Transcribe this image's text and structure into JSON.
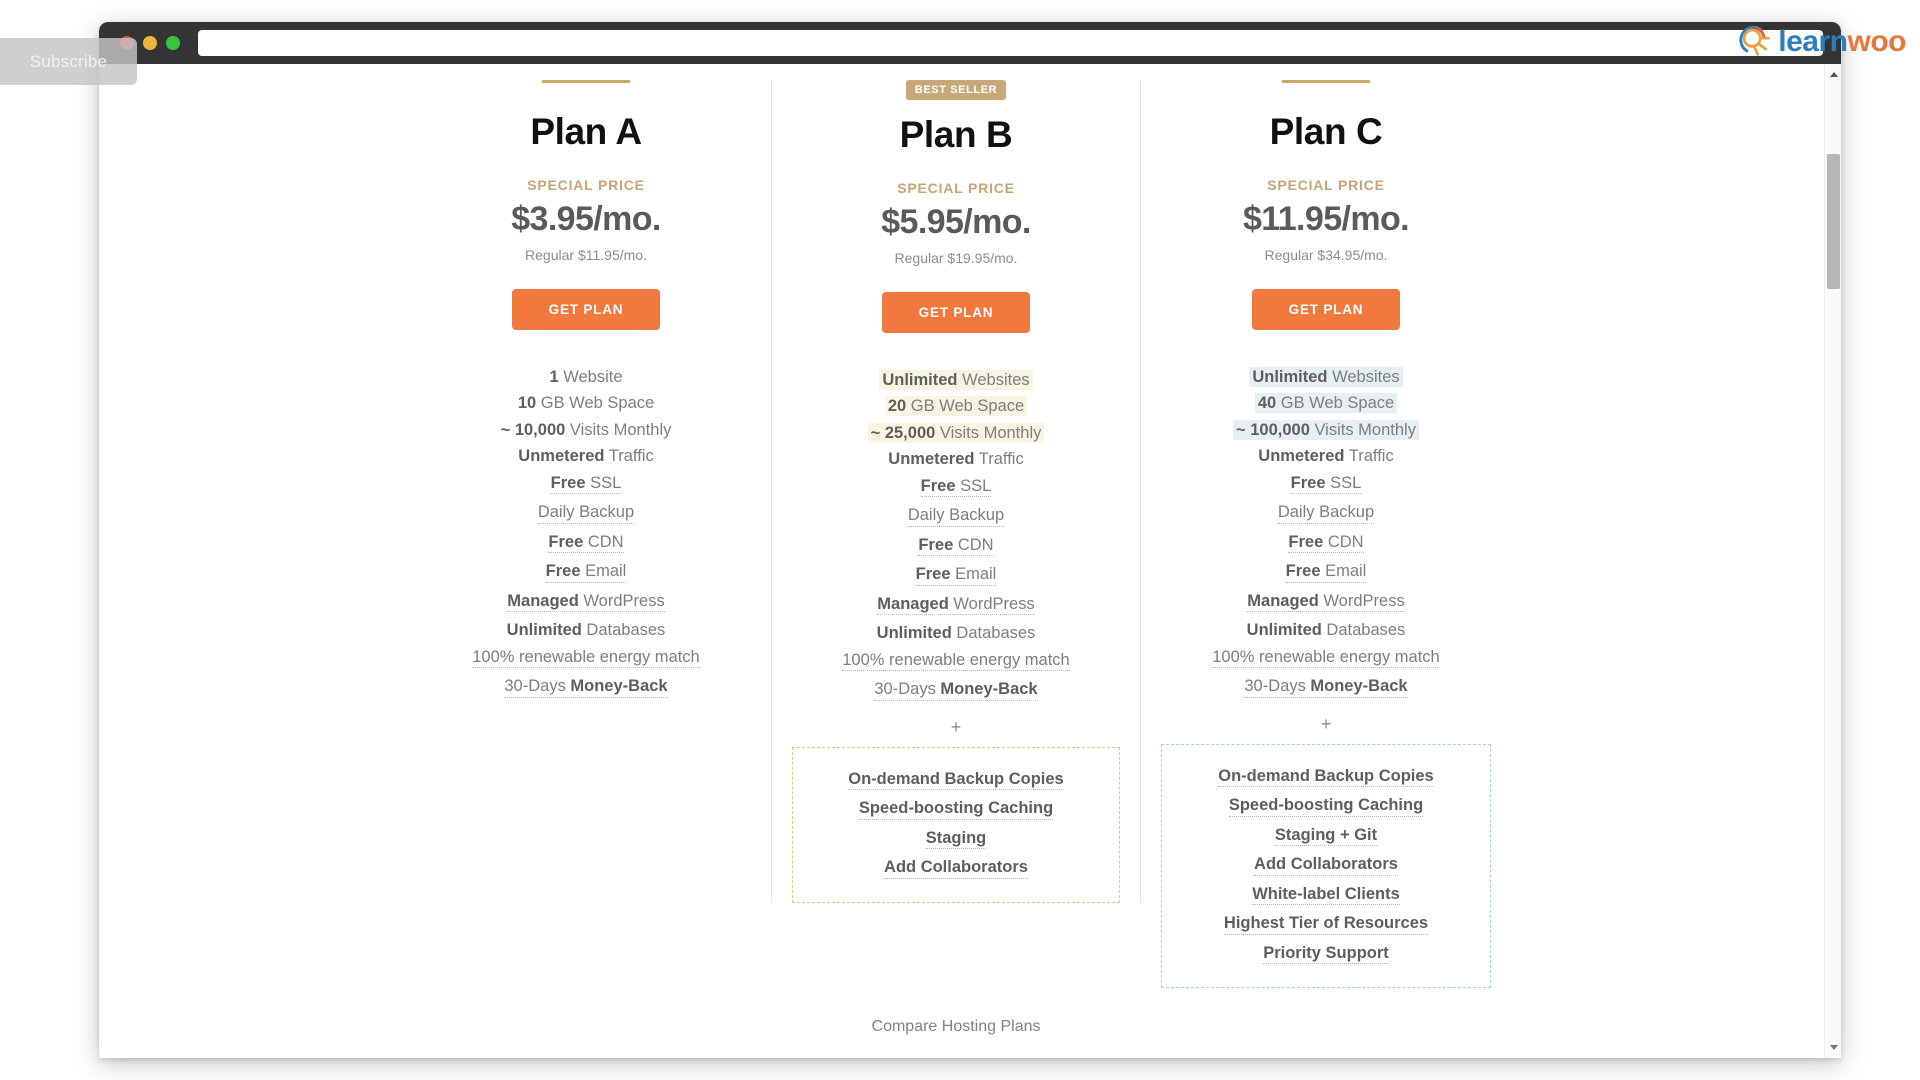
{
  "browser": {
    "address_value": "",
    "address_placeholder": "",
    "traffic_lights": [
      "close-red",
      "minimize-yellow",
      "maximize-green"
    ]
  },
  "overlay": {
    "subscribe_label": "Subscribe"
  },
  "brand": {
    "logo_part1": "learn",
    "logo_part2": "woo",
    "logo_icon": "sun-search-icon",
    "color_blue": "#2f7fbf",
    "color_orange": "#e8763f"
  },
  "colors": {
    "accent_orange": "#f2793d",
    "accent_gold": "#c9a878",
    "highlight_yellow": "#f7f4e2",
    "highlight_blue": "#e6eff2",
    "bonus_border_yellow": "#ddc87e",
    "bonus_border_teal": "#a8d4cf"
  },
  "labels": {
    "special_price": "SPECIAL PRICE",
    "best_seller": "BEST SELLER",
    "cta": "GET PLAN",
    "plus": "+",
    "compare_link": "Compare Hosting Plans"
  },
  "plans": [
    {
      "name": "Plan A",
      "badge": null,
      "price": "$3.95/mo.",
      "regular": "Regular $11.95/mo.",
      "highlight": null,
      "features": [
        {
          "bold": "1",
          "rest": " Website",
          "tooltip": false,
          "highlighted": false
        },
        {
          "bold": "10",
          "rest": " GB Web Space",
          "tooltip": false,
          "highlighted": false
        },
        {
          "bold": "~ 10,000",
          "rest": " Visits Monthly",
          "tooltip": false,
          "highlighted": false
        },
        {
          "bold": "Unmetered",
          "rest": " Traffic",
          "tooltip": false,
          "highlighted": false
        },
        {
          "bold": "Free",
          "rest": " SSL",
          "tooltip": true,
          "highlighted": false
        },
        {
          "bold": "",
          "rest": "Daily Backup",
          "tooltip": true,
          "highlighted": false
        },
        {
          "bold": "Free",
          "rest": " CDN",
          "tooltip": true,
          "highlighted": false
        },
        {
          "bold": "Free",
          "rest": " Email",
          "tooltip": true,
          "highlighted": false
        },
        {
          "bold": "Managed",
          "rest": " WordPress",
          "tooltip": true,
          "highlighted": false
        },
        {
          "bold": "Unlimited",
          "rest": " Databases",
          "tooltip": false,
          "highlighted": false
        },
        {
          "bold": "",
          "rest": "100% renewable energy match",
          "tooltip": true,
          "highlighted": false
        },
        {
          "bold": "",
          "rest": "30-Days ",
          "bold_after": "Money-Back",
          "tooltip": true,
          "highlighted": false
        }
      ],
      "bonus": null
    },
    {
      "name": "Plan B",
      "badge": "BEST SELLER",
      "price": "$5.95/mo.",
      "regular": "Regular $19.95/mo.",
      "highlight": "yellow",
      "features": [
        {
          "bold": "Unlimited",
          "rest": " Websites",
          "tooltip": false,
          "highlighted": true
        },
        {
          "bold": "20",
          "rest": " GB Web Space",
          "tooltip": false,
          "highlighted": true
        },
        {
          "bold": "~ 25,000",
          "rest": " Visits Monthly",
          "tooltip": false,
          "highlighted": true
        },
        {
          "bold": "Unmetered",
          "rest": " Traffic",
          "tooltip": false,
          "highlighted": false
        },
        {
          "bold": "Free",
          "rest": " SSL",
          "tooltip": true,
          "highlighted": false
        },
        {
          "bold": "",
          "rest": "Daily Backup",
          "tooltip": true,
          "highlighted": false
        },
        {
          "bold": "Free",
          "rest": " CDN",
          "tooltip": true,
          "highlighted": false
        },
        {
          "bold": "Free",
          "rest": " Email",
          "tooltip": true,
          "highlighted": false
        },
        {
          "bold": "Managed",
          "rest": " WordPress",
          "tooltip": true,
          "highlighted": false
        },
        {
          "bold": "Unlimited",
          "rest": " Databases",
          "tooltip": false,
          "highlighted": false
        },
        {
          "bold": "",
          "rest": "100% renewable energy match",
          "tooltip": true,
          "highlighted": false
        },
        {
          "bold": "",
          "rest": "30-Days ",
          "bold_after": "Money-Back",
          "tooltip": true,
          "highlighted": false
        }
      ],
      "bonus": {
        "style": "yellow",
        "items": [
          "On-demand Backup Copies",
          "Speed-boosting Caching",
          "Staging",
          "Add Collaborators"
        ]
      }
    },
    {
      "name": "Plan C",
      "badge": null,
      "price": "$11.95/mo.",
      "regular": "Regular $34.95/mo.",
      "highlight": "blue",
      "features": [
        {
          "bold": "Unlimited",
          "rest": " Websites",
          "tooltip": false,
          "highlighted": true
        },
        {
          "bold": "40",
          "rest": " GB Web Space",
          "tooltip": false,
          "highlighted": true
        },
        {
          "bold": "~ 100,000",
          "rest": " Visits Monthly",
          "tooltip": false,
          "highlighted": true
        },
        {
          "bold": "Unmetered",
          "rest": " Traffic",
          "tooltip": false,
          "highlighted": false
        },
        {
          "bold": "Free",
          "rest": " SSL",
          "tooltip": true,
          "highlighted": false
        },
        {
          "bold": "",
          "rest": "Daily Backup",
          "tooltip": true,
          "highlighted": false
        },
        {
          "bold": "Free",
          "rest": " CDN",
          "tooltip": true,
          "highlighted": false
        },
        {
          "bold": "Free",
          "rest": " Email",
          "tooltip": true,
          "highlighted": false
        },
        {
          "bold": "Managed",
          "rest": " WordPress",
          "tooltip": true,
          "highlighted": false
        },
        {
          "bold": "Unlimited",
          "rest": " Databases",
          "tooltip": false,
          "highlighted": false
        },
        {
          "bold": "",
          "rest": "100% renewable energy match",
          "tooltip": true,
          "highlighted": false
        },
        {
          "bold": "",
          "rest": "30-Days ",
          "bold_after": "Money-Back",
          "tooltip": true,
          "highlighted": false
        }
      ],
      "bonus": {
        "style": "teal",
        "items": [
          "On-demand Backup Copies",
          "Speed-boosting Caching",
          "Staging + Git",
          "Add Collaborators",
          "White-label Clients",
          "Highest Tier of Resources",
          "Priority Support"
        ]
      }
    }
  ],
  "scrollbar": {
    "up_arrow": "chevron-up-icon",
    "down_arrow": "chevron-down-icon",
    "thumb_position_percent": 9
  }
}
